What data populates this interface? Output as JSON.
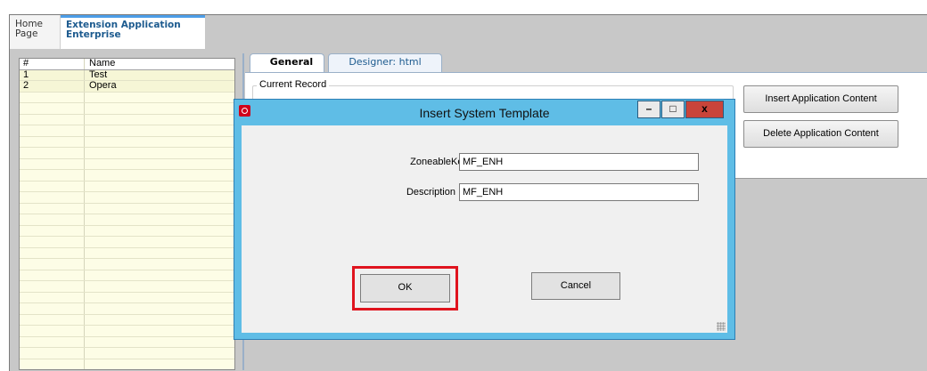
{
  "top_tabs": {
    "home": "Home\nPage",
    "extension": "Extension Application Enterprise"
  },
  "grid": {
    "columns": [
      "#",
      "Name"
    ],
    "rows": [
      {
        "num": "1",
        "name": "Test"
      },
      {
        "num": "2",
        "name": "Opera"
      }
    ]
  },
  "sub_tabs": {
    "general": "General",
    "designer": "Designer: html"
  },
  "current_record_label": "Current Record",
  "buttons": {
    "insert": "Insert Application Content",
    "delete": "Delete Application Content"
  },
  "dialog": {
    "title": "Insert System Template",
    "zoneable_label": "ZoneableKey",
    "zoneable_value": "MF_ENH",
    "description_label": "Description",
    "description_value": "MF_ENH",
    "ok": "OK",
    "cancel": "Cancel",
    "minimize": "–",
    "maximize": "□",
    "close": "x"
  },
  "colors": {
    "dialog_frame": "#5fbde6",
    "highlight": "#e0141e",
    "grid_bg": "#fdfde6"
  }
}
